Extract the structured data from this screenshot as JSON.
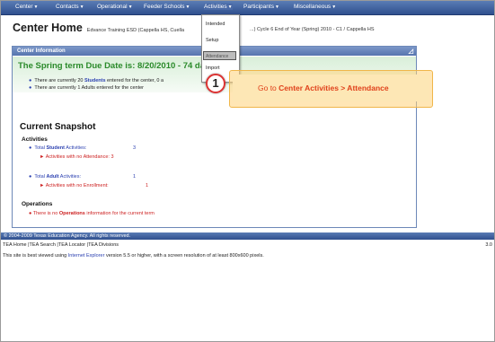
{
  "nav": {
    "items": [
      {
        "label": "Center"
      },
      {
        "label": "Contacts"
      },
      {
        "label": "Operational"
      },
      {
        "label": "Feeder Schools"
      },
      {
        "label": "Activities"
      },
      {
        "label": "Participants"
      },
      {
        "label": "Miscellaneous"
      }
    ],
    "caret": "▼"
  },
  "header": {
    "title": "Center Home",
    "subtitle_left": "Edvance Training ESD (Cappella HS, Cuella",
    "subtitle_right": "...) Cycle 6 End of Year (Spring) 2010 - C1 / Cappella HS"
  },
  "panel": {
    "header": "Center Information",
    "due_date": "The Spring term Due Date is: 8/20/2010 - 74 days",
    "students_prefix": "There are currently 20",
    "students_word": "Students",
    "students_suffix": "entered for the center, 0 a",
    "adults_text": "There are currently 1 Adults entered for the center"
  },
  "snapshot": {
    "title": "Current Snapshot",
    "activities_heading": "Activities",
    "total_student_label_a": "Total",
    "total_student_label_b": "Student",
    "total_student_label_c": "Activities:",
    "total_student_value": "3",
    "no_attendance_label": "Activities with no Attendance:",
    "no_attendance_value": "3",
    "total_adult_label_a": "Total",
    "total_adult_label_b": "Adult",
    "total_adult_label_c": "Activities:",
    "total_adult_value": "1",
    "no_enrollment_label": "Activities with no Enrollment:",
    "no_enrollment_value": "1",
    "operations_heading": "Operations",
    "operations_prefix": "There is no",
    "operations_word": "Operations",
    "operations_suffix": "information for the current term"
  },
  "dropdown": {
    "items": [
      "Intended",
      "Setup",
      "Attendance",
      "Import"
    ]
  },
  "callout": {
    "step": "1",
    "text_prefix": "Go to",
    "text_bold": "Center Activities > Attendance"
  },
  "footer": {
    "copyright": "© 2004-2009 Texas Education Agency. All rights reserved.",
    "links": "TEA Home  |TEA Search  |TEA Locator  |TEA Divisions",
    "version": "3.0",
    "browser_prefix": "This site is best viewed using",
    "browser_link": "Internet Explorer",
    "browser_suffix": "version 5.5 or higher, with a screen resolution of at least 800x600 pixels."
  },
  "colors": {
    "nav_bg": "#2f4f8e",
    "due_green": "#2a8a2a",
    "link_blue": "#2a3fb0",
    "alert_red": "#cc1f1f",
    "callout_orange": "#e0401a"
  }
}
